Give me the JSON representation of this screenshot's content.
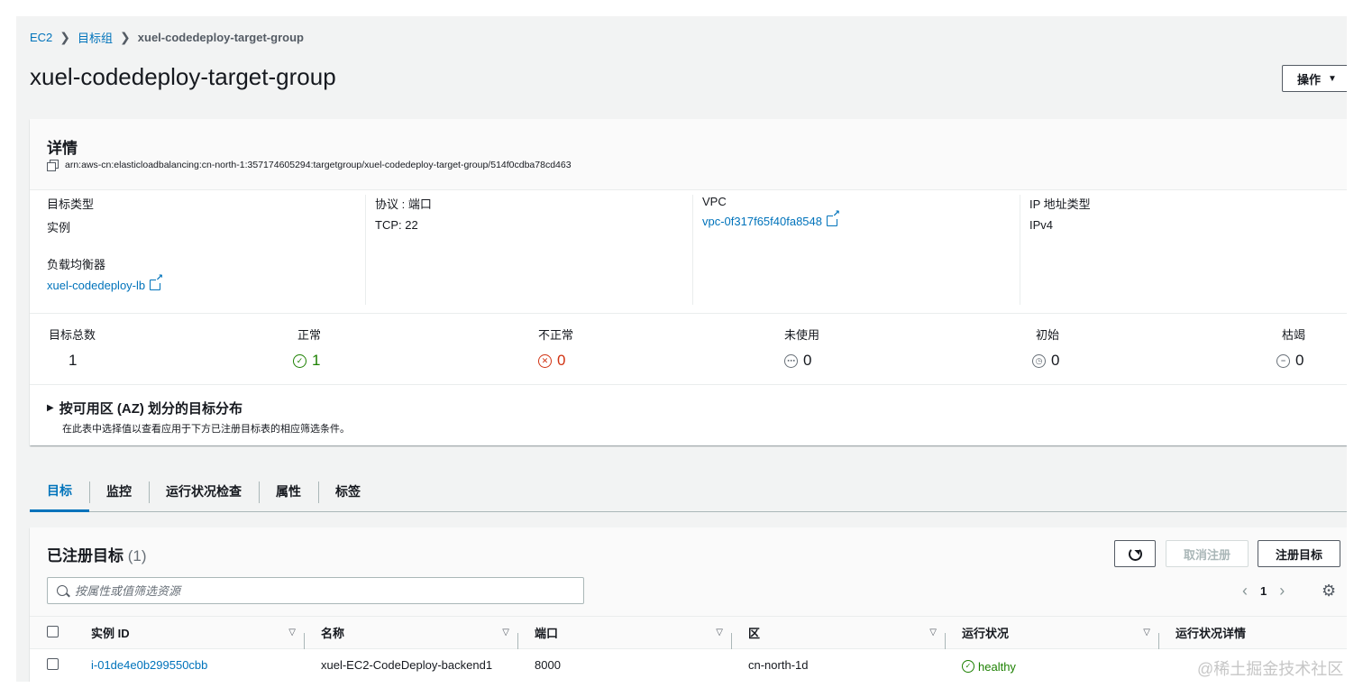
{
  "breadcrumb": {
    "root": "EC2",
    "parent": "目标组",
    "current": "xuel-codedeploy-target-group"
  },
  "page": {
    "title": "xuel-codedeploy-target-group",
    "actions_label": "操作"
  },
  "details": {
    "title": "详情",
    "arn": "arn:aws-cn:elasticloadbalancing:cn-north-1:357174605294:targetgroup/xuel-codedeploy-target-group/514f0cdba78cd463",
    "target_type_label": "目标类型",
    "target_type_value": "实例",
    "load_balancer_label": "负载均衡器",
    "load_balancer_value": "xuel-codedeploy-lb",
    "protocol_label": "协议 : 端口",
    "protocol_value": "TCP: 22",
    "vpc_label": "VPC",
    "vpc_value": "vpc-0f317f65f40fa8548",
    "ip_type_label": "IP 地址类型",
    "ip_type_value": "IPv4"
  },
  "stats": {
    "total_label": "目标总数",
    "total_value": "1",
    "healthy_label": "正常",
    "healthy_value": "1",
    "unhealthy_label": "不正常",
    "unhealthy_value": "0",
    "unused_label": "未使用",
    "unused_value": "0",
    "initial_label": "初始",
    "initial_value": "0",
    "draining_label": "枯竭",
    "draining_value": "0"
  },
  "az": {
    "title": "按可用区 (AZ) 划分的目标分布",
    "description": "在此表中选择值以查看应用于下方已注册目标表的相应筛选条件。"
  },
  "tabs": [
    "目标",
    "监控",
    "运行状况检查",
    "属性",
    "标签"
  ],
  "targets": {
    "title": "已注册目标",
    "count": "(1)",
    "deregister_label": "取消注册",
    "register_label": "注册目标",
    "search_placeholder": "按属性或值筛选资源",
    "page_number": "1",
    "columns": [
      "实例 ID",
      "名称",
      "端口",
      "区",
      "运行状况",
      "运行状况详情"
    ],
    "rows": [
      {
        "instance_id": "i-01de4e0b299550cbb",
        "name": "xuel-EC2-CodeDeploy-backend1",
        "port": "8000",
        "zone": "cn-north-1d",
        "health": "healthy",
        "health_details": ""
      }
    ]
  },
  "watermark": "@稀土掘金技术社区",
  "colors": {
    "link": "#0073bb",
    "healthy": "#1d8102",
    "unhealthy": "#d13212",
    "neutral": "#687078",
    "background": "#f2f3f3"
  }
}
